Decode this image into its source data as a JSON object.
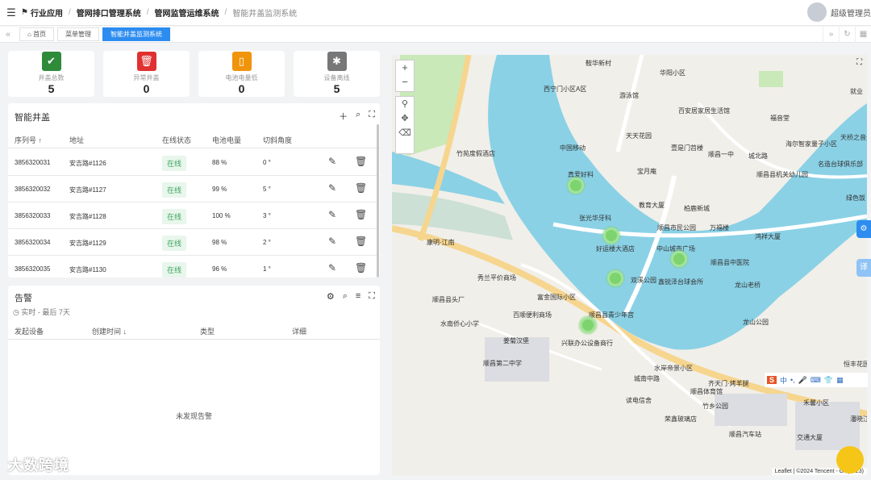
{
  "breadcrumb": [
    "行业应用",
    "管网排口管理系统",
    "管网监管运维系统",
    "智能井盖监测系统"
  ],
  "user": {
    "name": "超级管理员"
  },
  "tabs": [
    {
      "label": "首页"
    },
    {
      "label": "菜单管理"
    },
    {
      "label": "智能井盖监测系统"
    }
  ],
  "stats": [
    {
      "label": "井盖总数",
      "value": "5",
      "color": "#2e8b3a",
      "icon": "check-icon"
    },
    {
      "label": "异常井盖",
      "value": "0",
      "color": "#e03131",
      "icon": "trash-alert-icon"
    },
    {
      "label": "电池电量低",
      "value": "0",
      "color": "#f0940b",
      "icon": "battery-low-icon"
    },
    {
      "label": "设备离线",
      "value": "5",
      "color": "#777777",
      "icon": "wifi-off-icon"
    }
  ],
  "manholes": {
    "title": "智能井盖",
    "columns": [
      "序列号",
      "地址",
      "在线状态",
      "电池电量",
      "切斜角度"
    ],
    "rows": [
      {
        "serial": "3856320031",
        "address": "安吉路#1126",
        "status": "在线",
        "battery": "88 %",
        "angle": "0 °"
      },
      {
        "serial": "3856320032",
        "address": "安吉路#1127",
        "status": "在线",
        "battery": "99 %",
        "angle": "5 °"
      },
      {
        "serial": "3856320033",
        "address": "安吉路#1128",
        "status": "在线",
        "battery": "100 %",
        "angle": "3 °"
      },
      {
        "serial": "3856320034",
        "address": "安吉路#1129",
        "status": "在线",
        "battery": "98 %",
        "angle": "2 °"
      },
      {
        "serial": "3856320035",
        "address": "安吉路#1130",
        "status": "在线",
        "battery": "96 %",
        "angle": "1 °"
      }
    ]
  },
  "alerts": {
    "title": "告警",
    "timerange": "实时 - 最后 7天",
    "columns": [
      "发起设备",
      "创建时间",
      "类型",
      "详细"
    ],
    "empty": "未发现告警"
  },
  "map": {
    "labels": [
      "鞍华新村",
      "华阳小区",
      "西宁门小区A区",
      "游泳馆",
      "百安居家居生活馆",
      "福音堂",
      "就业",
      "竹苑度假酒店",
      "中国移动",
      "天天花园",
      "壹是门苕楼",
      "顺昌一中",
      "城北路",
      "海尔智家量子小区",
      "天桥之音生活小区",
      "名造台球俱乐部",
      "宝月庵",
      "顺昌县机关幼儿园",
      "绿色饭",
      "真爱好料",
      "张光华牙科",
      "教育大厦",
      "柏鹿新城",
      "万福楼",
      "顺昌市民公园",
      "鸿祥大厦",
      "好运楼大酒店",
      "中山城市广场",
      "顺昌县中医院",
      "龙山老桥",
      "龙山公园",
      "双溪公园",
      "鑫锐泽台球会所",
      "秀兰平价商场",
      "富金国际小区",
      "顺昌县头厂",
      "百顺便利商场",
      "顺昌县青少年宫",
      "水南侨心小学",
      "姜菊汉堡",
      "兴联办公设备商行",
      "顺昌第二中学",
      "水岸帝景小区",
      "齐天门·烤羊腿",
      "顺昌体育馆",
      "竹乡公园",
      "恒丰花园",
      "禾馨小区",
      "读电信舍",
      "荣鑫玻璃店",
      "顺昌汽车站",
      "交通大厦",
      "潘晓江饭",
      "康明·江南",
      "城南中路"
    ],
    "attribution": "Leaflet | ©2024 Tencent - GS(2023)"
  },
  "watermark": "大数跨境"
}
